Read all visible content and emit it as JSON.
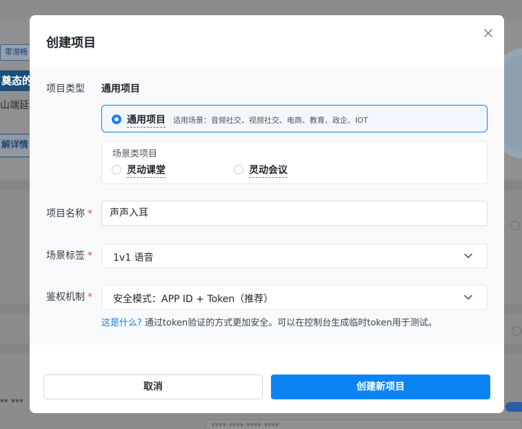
{
  "background": {
    "tag_text": "零滞畅",
    "banner_text": "奠态的",
    "line_text": "山端延时",
    "button_text": "解详情",
    "masked_text": "** ***",
    "input_text": "**** **** **** ****"
  },
  "modal": {
    "title": "创建项目",
    "close_icon": "close-icon",
    "project_type": {
      "label": "项目类型",
      "value": "通用项目",
      "general_option": {
        "label": "通用项目",
        "description": "适用场景：音频社交、视频社交、电商、教育、政企、IOT",
        "selected": true
      },
      "scene_group": {
        "title": "场景类项目",
        "options": [
          {
            "label": "灵动课堂",
            "selected": false
          },
          {
            "label": "灵动会议",
            "selected": false
          }
        ]
      }
    },
    "project_name": {
      "label": "项目名称",
      "required_mark": "*",
      "value": "声声入耳"
    },
    "scene_tag": {
      "label": "场景标签",
      "required_mark": "*",
      "value": "1v1 语音"
    },
    "auth": {
      "label": "鉴权机制",
      "required_mark": "*",
      "value": "安全模式：APP ID + Token（推荐）",
      "hint_link": "这是什么?",
      "hint_text": "通过token验证的方式更加安全。可以在控制台生成临时token用于测试。"
    },
    "buttons": {
      "cancel": "取消",
      "create": "创建新项目"
    }
  },
  "colors": {
    "accent": "#1a7eeb",
    "primary_button": "#0a84f5",
    "required": "#e84a3c",
    "overlay": "#8c8c8e"
  }
}
